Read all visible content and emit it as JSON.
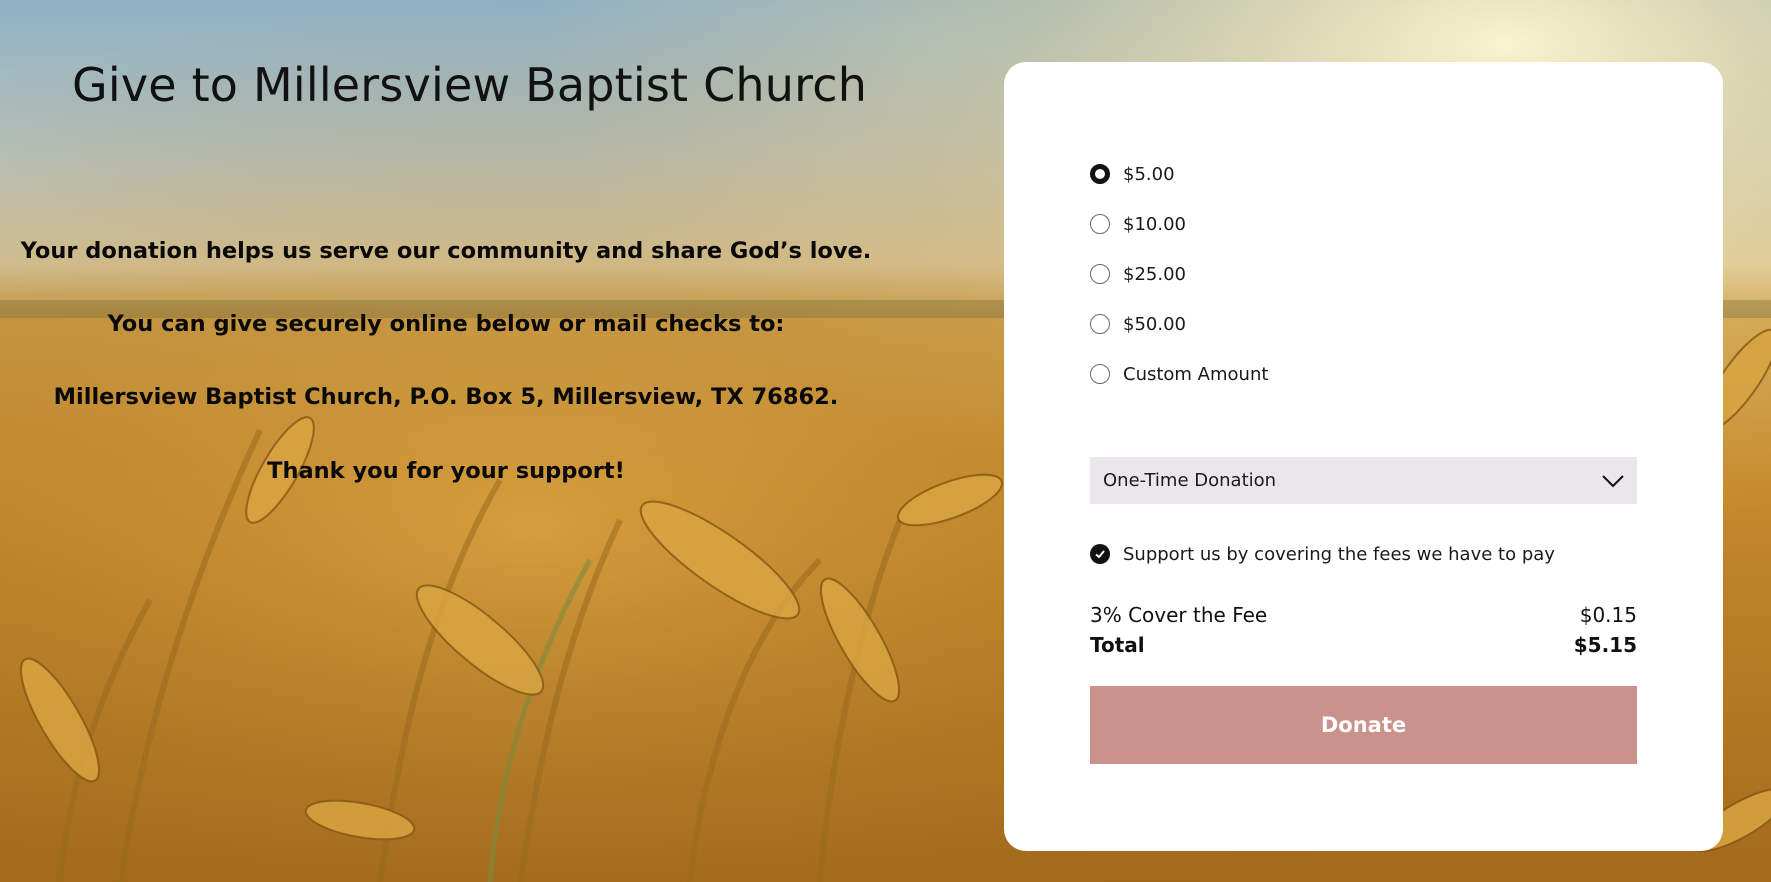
{
  "page": {
    "title": "Give to Millersview Baptist Church",
    "lines": [
      "Your donation helps us serve our community and share God’s love.",
      "You can give securely online below or mail checks to:",
      "Millersview Baptist Church, P.O. Box 5, Millersview, TX 76862.",
      "Thank you for your support!"
    ]
  },
  "form": {
    "amounts": [
      {
        "label": "$5.00",
        "selected": true
      },
      {
        "label": "$10.00",
        "selected": false
      },
      {
        "label": "$25.00",
        "selected": false
      },
      {
        "label": "$50.00",
        "selected": false
      },
      {
        "label": "Custom Amount",
        "selected": false
      }
    ],
    "frequency": {
      "selected": "One-Time Donation",
      "icon": "chevron-down-icon"
    },
    "cover_fees": {
      "label": "Support us by covering the fees we have to pay",
      "checked": true
    },
    "fee": {
      "label": "3% Cover the Fee",
      "value": "$0.15"
    },
    "total": {
      "label": "Total",
      "value": "$5.15"
    },
    "donate_label": "Donate"
  },
  "colors": {
    "donate_button": "#cb928d",
    "card": "#ffffff",
    "select_bg": "#e9e7ec"
  }
}
